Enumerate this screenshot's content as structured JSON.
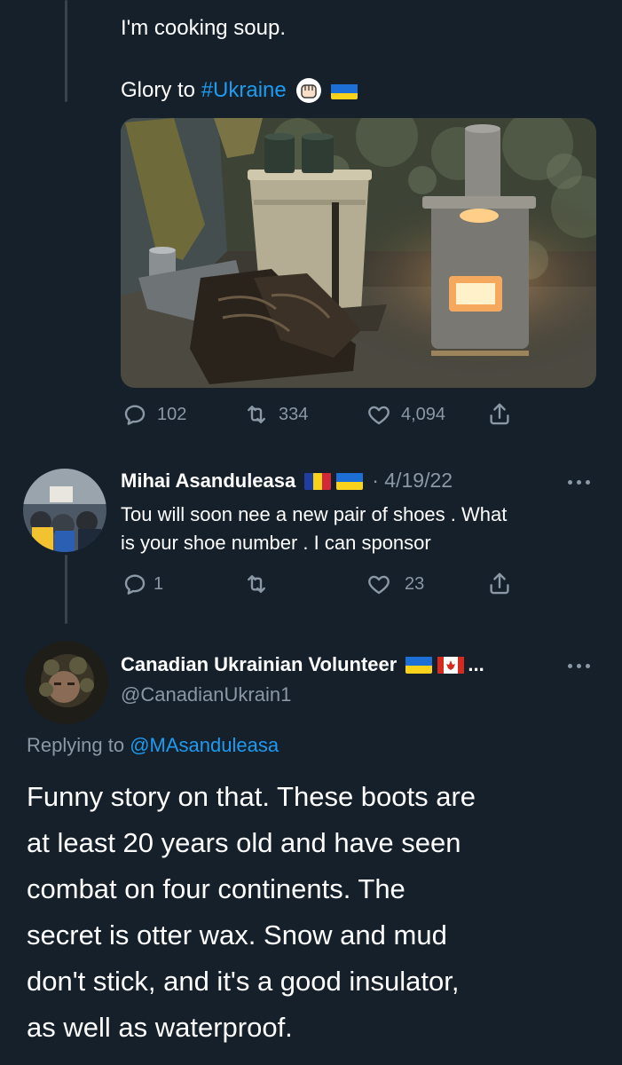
{
  "tweet1": {
    "line1": "I'm cooking soup.",
    "line2_prefix": "Glory to ",
    "hashtag": "#Ukraine",
    "actions": {
      "replies": "102",
      "retweets": "334",
      "likes": "4,094"
    }
  },
  "reply1": {
    "name": "Mihai Asanduleasa",
    "date": "· 4/19/22",
    "text_line1": "Tou will soon nee a new pair of shoes . What",
    "text_line2": "is your shoe number . I can sponsor",
    "actions": {
      "replies": "1",
      "retweets": "",
      "likes": "23"
    }
  },
  "focus": {
    "name": "Canadian Ukrainian Volunteer",
    "name_suffix": "...",
    "handle": "@CanadianUkrain1",
    "replying_prefix": "Replying to ",
    "replying_handle": "@MAsanduleasa",
    "text_lines": [
      "Funny story on that. These boots are",
      "at least 20 years old and have seen",
      "combat on four continents. The",
      "secret is otter wax. Snow and mud",
      "don't stick, and it's a good insulator,",
      "as well as waterproof."
    ]
  },
  "colors": {
    "background": "#15202b",
    "accent": "#1d9bf0",
    "muted": "#8b98a5",
    "thread_line": "#38444d"
  },
  "icons": [
    "raised-fist-emoji",
    "ukraine-flag",
    "romania-flag",
    "canada-flag",
    "reply-icon",
    "retweet-icon",
    "like-icon",
    "share-icon",
    "more-icon"
  ]
}
